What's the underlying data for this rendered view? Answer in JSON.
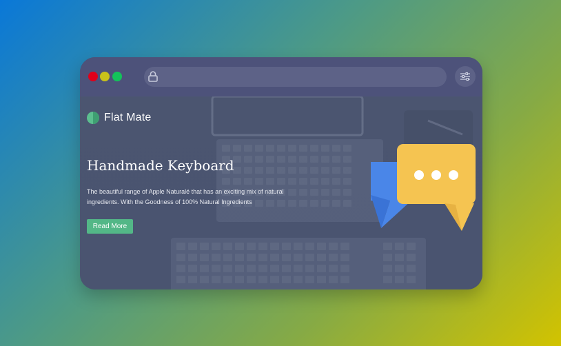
{
  "window": {
    "traffic_lights": [
      {
        "name": "close",
        "color": "#e0001a"
      },
      {
        "name": "minimize",
        "color": "#c9c21a"
      },
      {
        "name": "maximize",
        "color": "#13c35a"
      }
    ],
    "address_bar": {
      "icon": "lock-icon",
      "value": ""
    },
    "settings_icon": "sliders-icon"
  },
  "brand": {
    "name": "Flat Mate",
    "logo_color": "#5cbf8f"
  },
  "hero": {
    "title": "Handmade Keyboard",
    "description": "The beautiful range of Apple Naturalé that has an exciting mix of natural ingredients. With the Goodness of 100% Natural Ingredients",
    "cta_label": "Read More",
    "cta_color": "#53b787"
  },
  "illustration": {
    "icon": "chat-bubbles-icon",
    "colors": [
      "#4a86e8",
      "#f5c451",
      "#ffffff"
    ]
  }
}
